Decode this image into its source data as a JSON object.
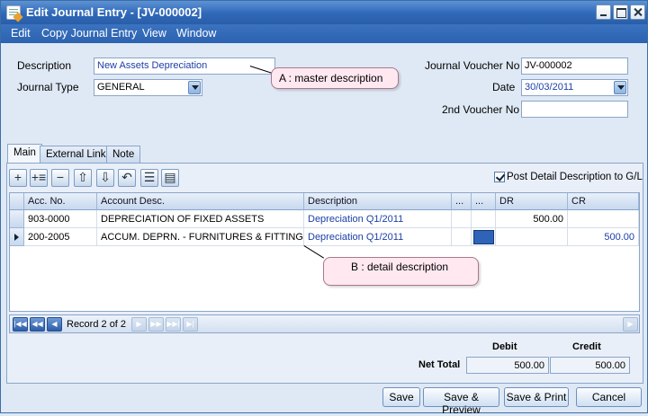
{
  "window": {
    "title": "Edit Journal Entry - [JV-000002]"
  },
  "menu": [
    "Edit",
    "Copy Journal Entry",
    "View",
    "Window"
  ],
  "form": {
    "description_label": "Description",
    "description_value": "New Assets Depreciation",
    "journal_type_label": "Journal Type",
    "journal_type_value": "GENERAL",
    "voucher_no_label": "Journal Voucher No",
    "voucher_no_value": "JV-000002",
    "date_label": "Date",
    "date_value": "30/03/2011",
    "second_voucher_label": "2nd Voucher No",
    "second_voucher_value": ""
  },
  "callouts": {
    "a": "A : master description",
    "b": "B : detail description"
  },
  "tabs": [
    "Main",
    "External Link",
    "Note"
  ],
  "toolbar": {
    "icons": [
      "add-row-icon",
      "insert-row-icon",
      "delete-row-icon",
      "move-up-icon",
      "move-down-icon",
      "undo-icon",
      "list-icon",
      "detail-icon"
    ],
    "post_detail_label": "Post Detail Description to G/L",
    "post_detail_checked": true
  },
  "grid": {
    "columns": [
      "Acc. No.",
      "Account Desc.",
      "Description",
      "...",
      "...",
      "DR",
      "CR"
    ],
    "rows": [
      [
        "903-0000",
        "DEPRECIATION OF FIXED ASSETS",
        "Depreciation Q1/2011",
        "",
        "",
        "500.00",
        ""
      ],
      [
        "200-2005",
        "ACCUM. DEPRN. - FURNITURES & FITTINGS",
        "Depreciation Q1/2011",
        "",
        "",
        "",
        "500.00"
      ]
    ],
    "current_row": 1
  },
  "navigator": {
    "record_text": "Record 2 of 2"
  },
  "totals": {
    "debit_label": "Debit",
    "credit_label": "Credit",
    "net_total_label": "Net Total",
    "debit_value": "500.00",
    "credit_value": "500.00"
  },
  "buttons": {
    "save": "Save",
    "save_preview": "Save & Preview",
    "save_print": "Save & Print",
    "cancel": "Cancel"
  },
  "colors": {
    "title_bar": "#2f68b8",
    "link_text": "#1a3fa8",
    "callout_fill": "#ffe8f0"
  }
}
